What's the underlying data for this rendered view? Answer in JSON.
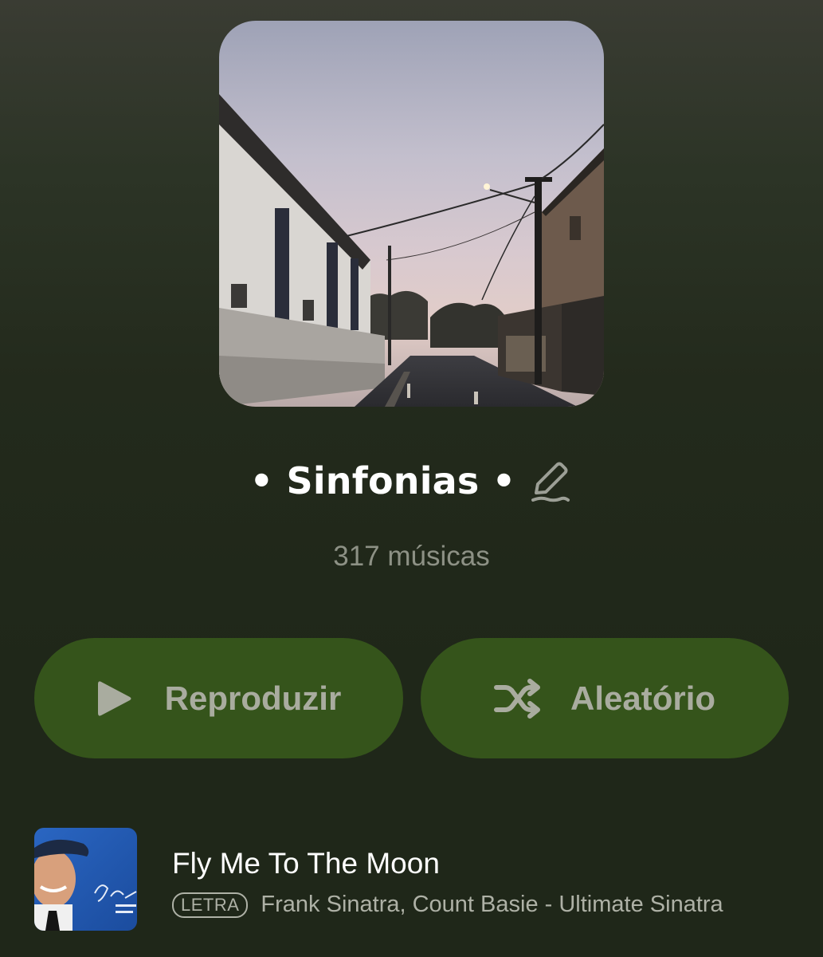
{
  "playlist": {
    "title": "• Sinfonias •",
    "song_count": "317 músicas",
    "cover_icon": "playlist-cover-image",
    "edit_icon": "pencil-icon"
  },
  "actions": {
    "play_label": "Reproduzir",
    "play_icon": "play-icon",
    "shuffle_label": "Aleatório",
    "shuffle_icon": "shuffle-icon"
  },
  "tracks": [
    {
      "title": "Fly Me To The Moon",
      "badge": "LETRA",
      "subtitle": "Frank Sinatra, Count Basie - Ultimate Sinatra"
    }
  ],
  "colors": {
    "button_bg": "#35541b",
    "button_text": "#a9ac9f",
    "background": "#1f2719"
  }
}
